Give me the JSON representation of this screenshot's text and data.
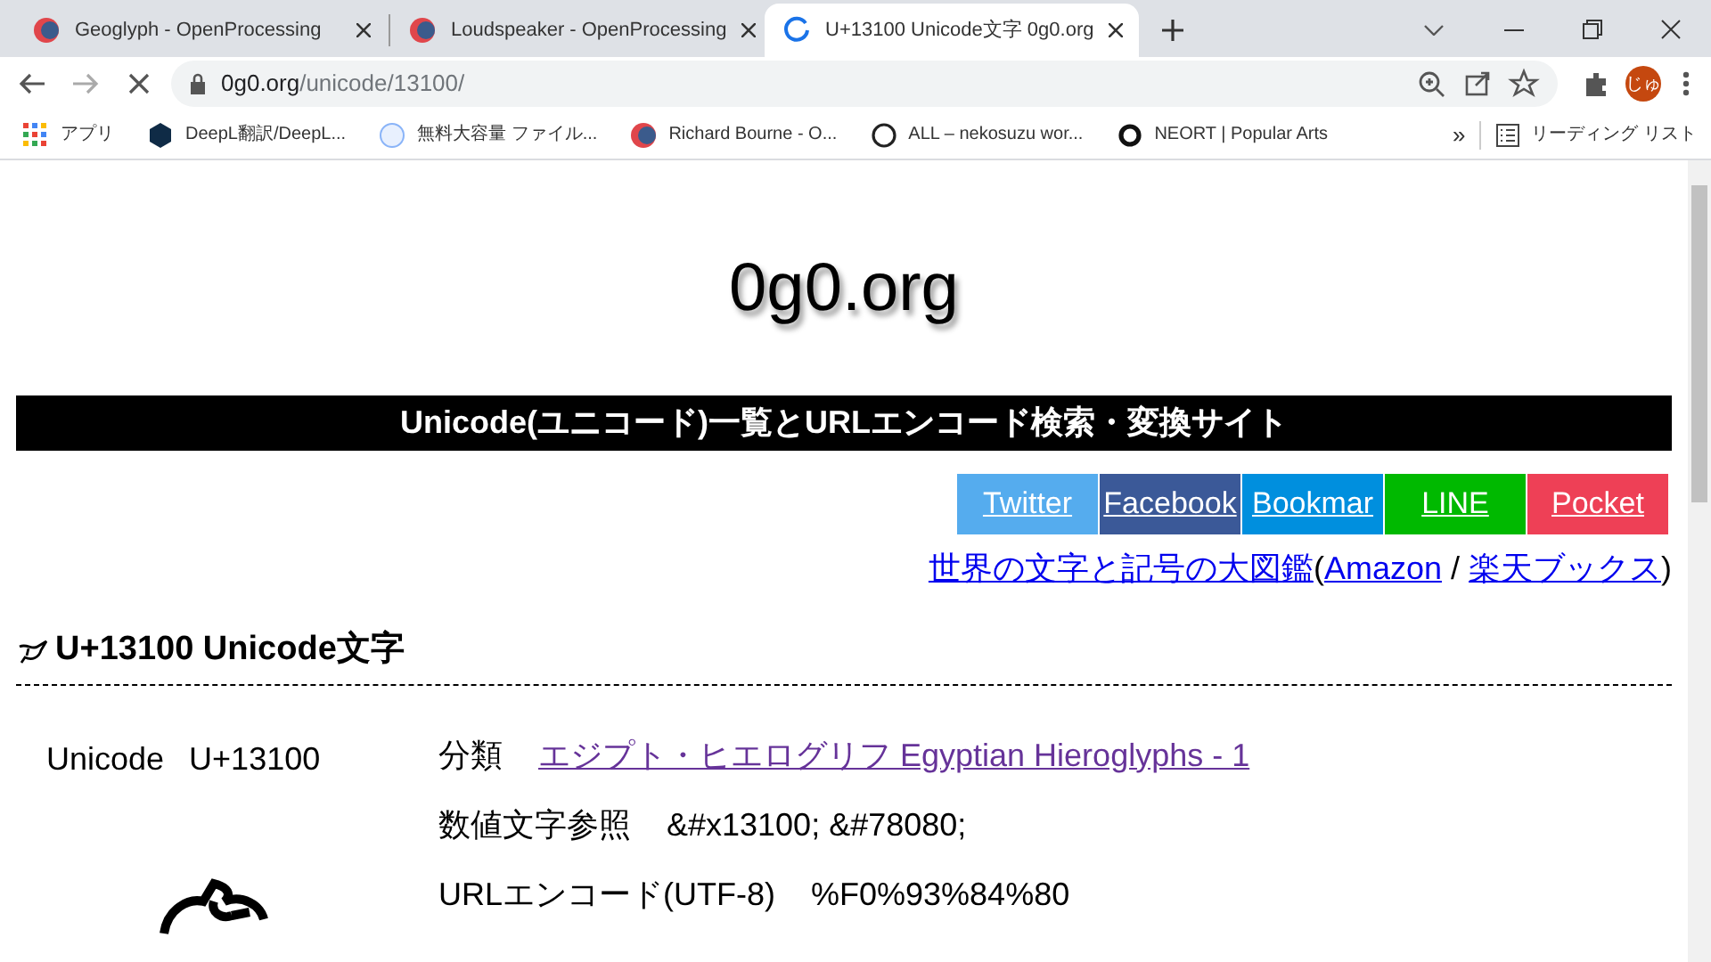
{
  "browser": {
    "tabs": [
      {
        "title": "Geoglyph - OpenProcessing",
        "selected": false,
        "loading": false
      },
      {
        "title": "Loudspeaker - OpenProcessing",
        "selected": false,
        "loading": false
      },
      {
        "title": "U+13100 Unicode文字 0g0.org",
        "selected": true,
        "loading": true
      }
    ],
    "address": {
      "host": "0g0.org",
      "path": "/unicode/13100/"
    },
    "profile_initials": "じゅ",
    "bookmarks": [
      {
        "label": "アプリ",
        "kind": "apps"
      },
      {
        "label": "DeepL翻訳/DeepL...",
        "kind": "deepl"
      },
      {
        "label": "無料大容量 ファイル...",
        "kind": "globe"
      },
      {
        "label": "Richard Bourne - O...",
        "kind": "op"
      },
      {
        "label": "ALL – nekosuzu wor...",
        "kind": "circle"
      },
      {
        "label": "NEORT | Popular Arts",
        "kind": "neort"
      }
    ],
    "more_bookmarks": "»",
    "reading_list": "リーディング リスト"
  },
  "page": {
    "site_title": "0g0.org",
    "banner": "Unicode(ユニコード)一覧とURLエンコード検索・変換サイト",
    "share_buttons": [
      {
        "label": "Twitter",
        "color": "#55acee"
      },
      {
        "label": "Facebook",
        "color": "#3b5998"
      },
      {
        "label": "Bookmar",
        "color": "#008fde"
      },
      {
        "label": "LINE",
        "color": "#00b900"
      },
      {
        "label": "Pocket",
        "color": "#ee4056"
      }
    ],
    "book": {
      "title_link": "世界の文字と記号の大図鑑",
      "open": "(",
      "link_1": "Amazon",
      "sep": " / ",
      "link_2": "楽天ブックス",
      "close": ")"
    },
    "heading": "U+13100 Unicode文字",
    "code_label": "Unicode",
    "code_value": "U+13100",
    "rows": [
      {
        "label": "分類",
        "value": "エジプト・ヒエログリフ Egyptian Hieroglyphs - 1",
        "kind": "link"
      },
      {
        "label": "数値文字参照",
        "value": "&#x13100; &#78080;",
        "kind": "text"
      },
      {
        "label": "URLエンコード(UTF-8)",
        "value": "%F0%93%84%80",
        "kind": "text"
      }
    ]
  }
}
